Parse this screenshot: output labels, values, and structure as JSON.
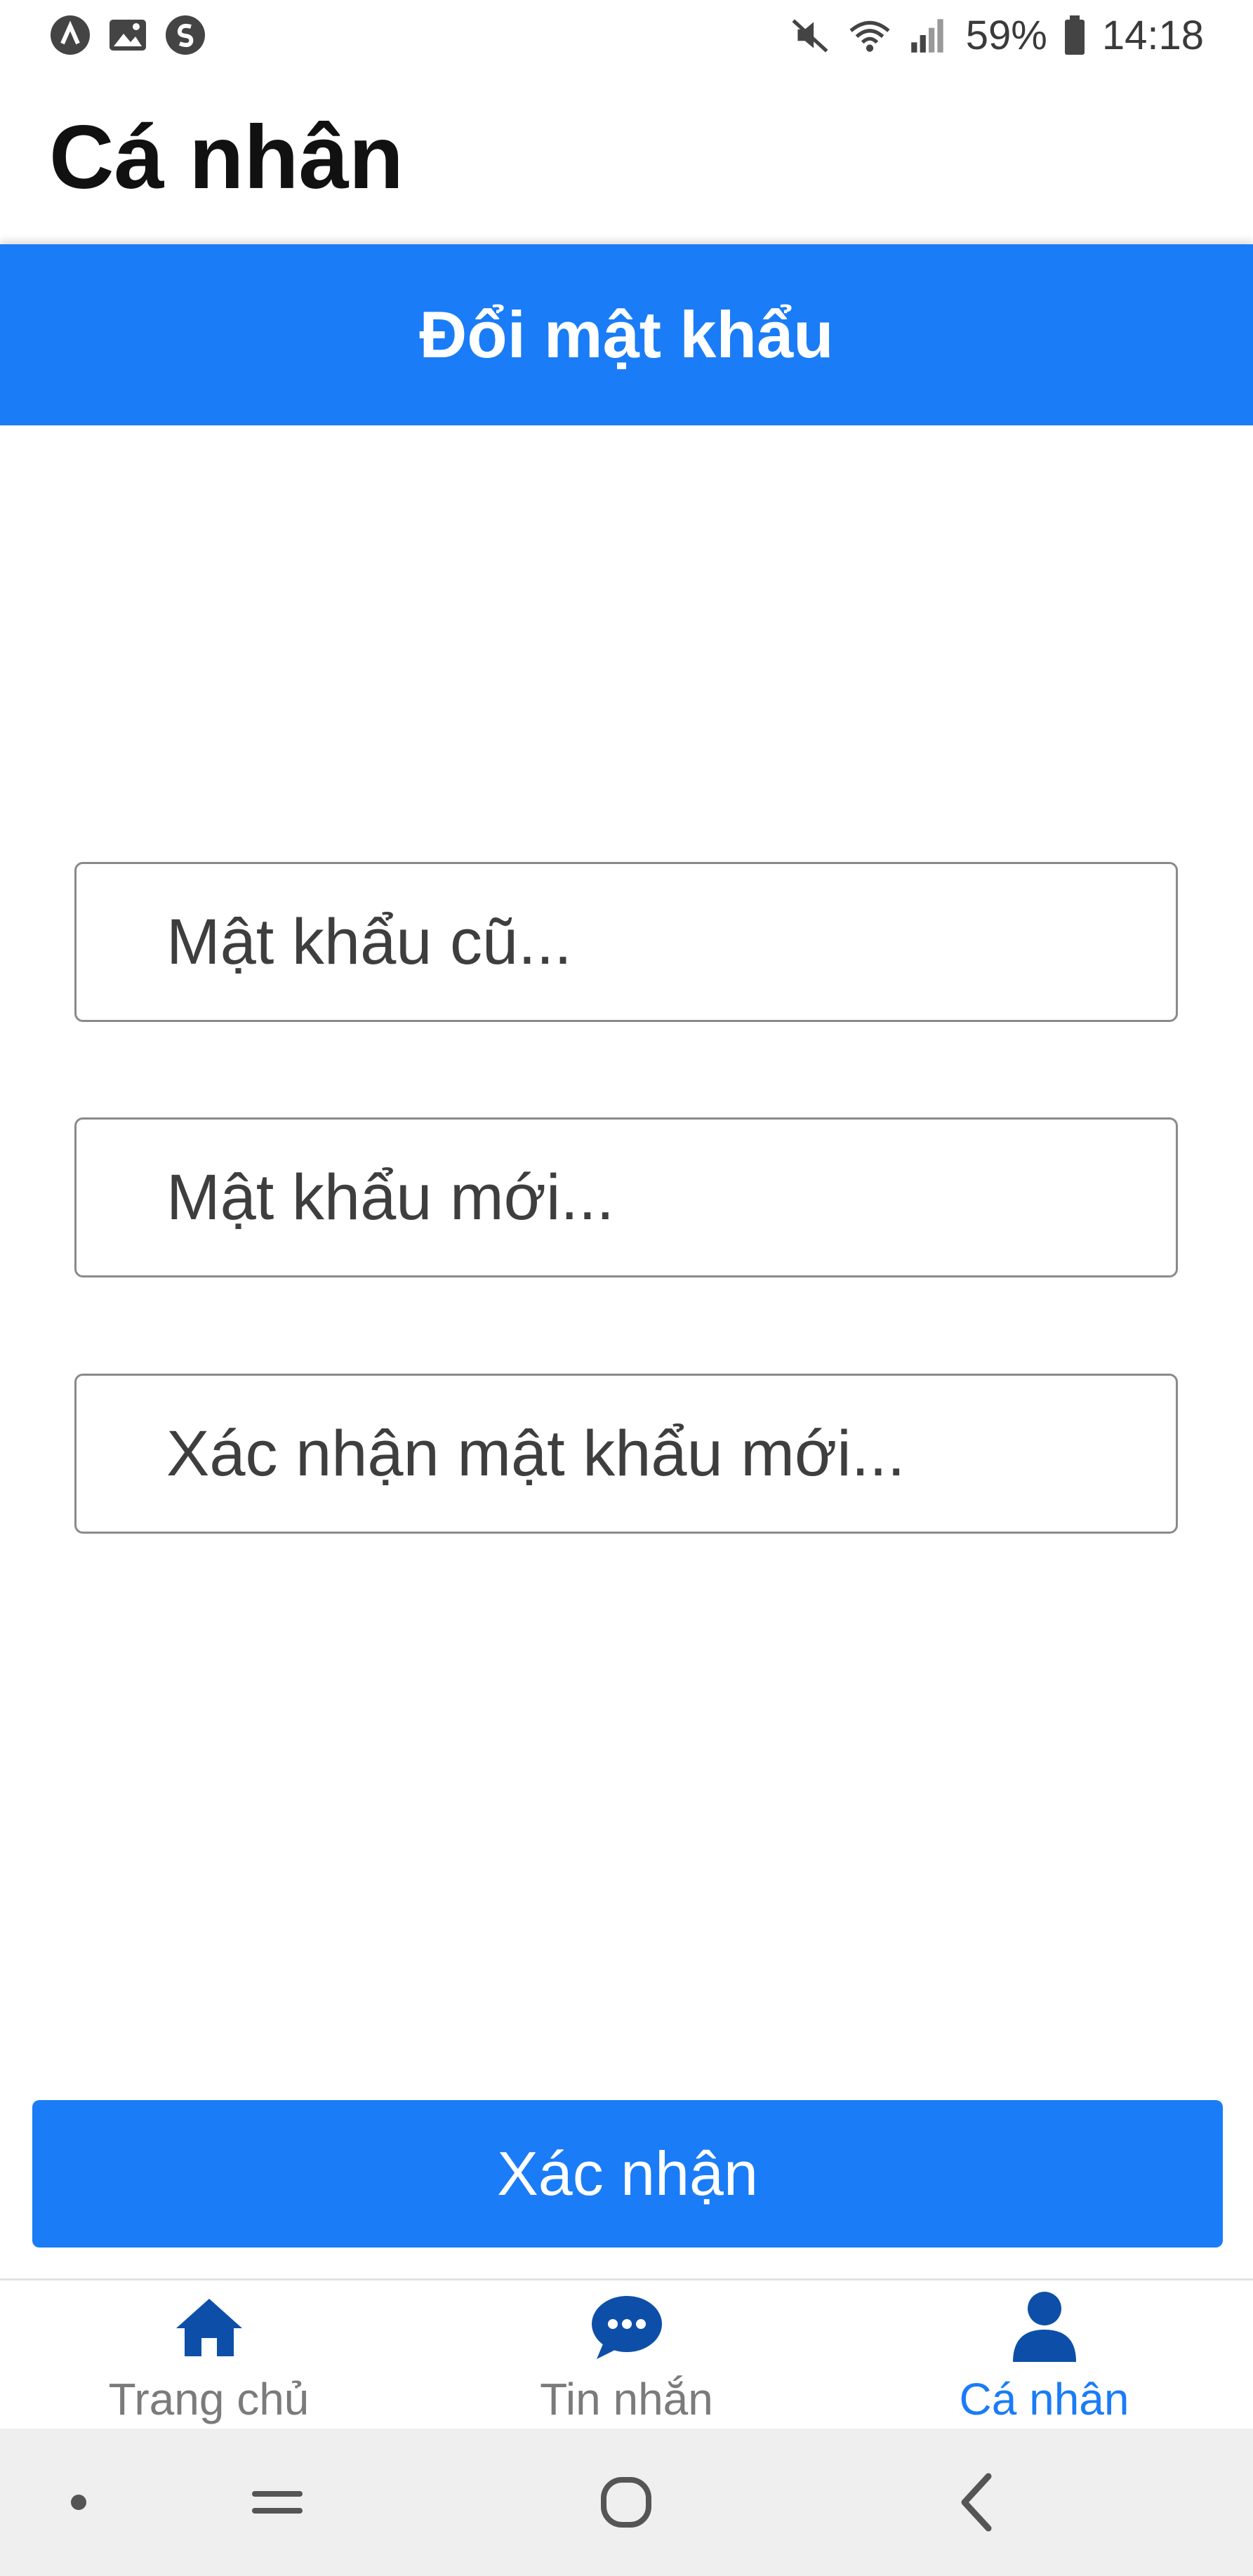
{
  "status_bar": {
    "battery": "59%",
    "time": "14:18"
  },
  "header": {
    "title": "Cá nhân"
  },
  "banner": {
    "title": "Đổi mật khẩu"
  },
  "form": {
    "old_password_placeholder": "Mật khẩu cũ...",
    "new_password_placeholder": "Mật khẩu mới...",
    "confirm_password_placeholder": "Xác nhận mật khẩu mới..."
  },
  "confirm_button": {
    "label": "Xác nhận"
  },
  "tabs": [
    {
      "label": "Trang chủ",
      "icon": "home-icon",
      "active": false
    },
    {
      "label": "Tin nhắn",
      "icon": "chat-icon",
      "active": false
    },
    {
      "label": "Cá nhân",
      "icon": "person-icon",
      "active": true
    }
  ],
  "colors": {
    "accent": "#1a7cf7",
    "tab_icon": "#0d4fa8",
    "tab_inactive_text": "#7b7b7b"
  }
}
